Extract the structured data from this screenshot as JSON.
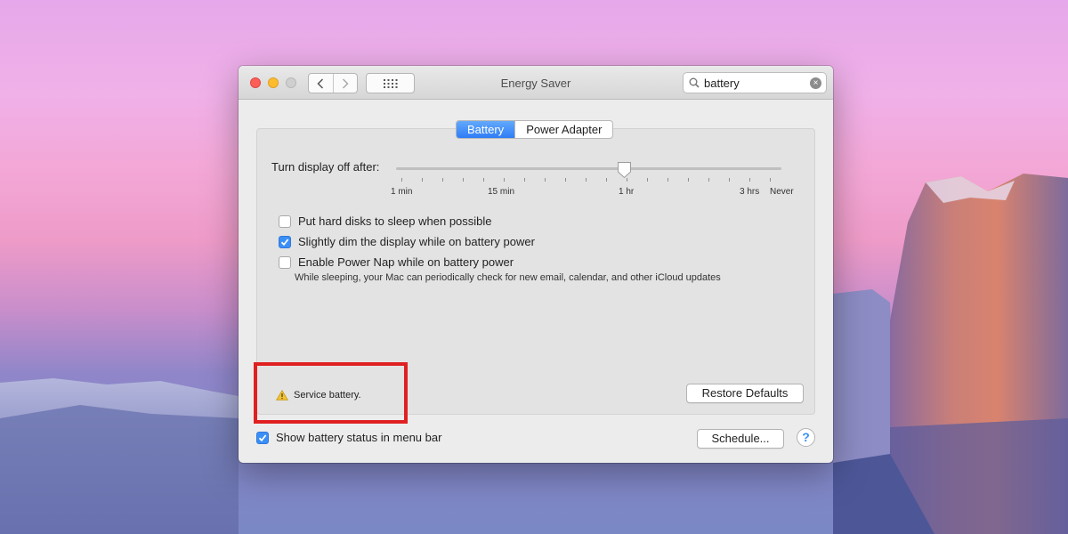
{
  "window": {
    "title": "Energy Saver",
    "search_value": "battery"
  },
  "tabs": [
    {
      "label": "Battery",
      "active": true
    },
    {
      "label": "Power Adapter",
      "active": false
    }
  ],
  "slider": {
    "label": "Turn display off after:",
    "current_value": "1 hr",
    "ticks": [
      "1 min",
      "15 min",
      "1 hr",
      "3 hrs",
      "Never"
    ]
  },
  "options": [
    {
      "label": "Put hard disks to sleep when possible",
      "checked": false
    },
    {
      "label": "Slightly dim the display while on battery power",
      "checked": true
    },
    {
      "label": "Enable Power Nap while on battery power",
      "checked": false
    }
  ],
  "power_nap_hint": "While sleeping, your Mac can periodically check for new email, calendar, and other iCloud updates",
  "warning": {
    "text": "Service battery.",
    "icon": "warning-triangle-icon"
  },
  "buttons": {
    "restore": "Restore Defaults",
    "schedule": "Schedule...",
    "help": "?"
  },
  "menu_bar_option": {
    "label": "Show battery status in menu bar",
    "checked": true
  },
  "colors": {
    "accent": "#3a8ff6",
    "highlight_box": "#e02020",
    "close": "#fc5f57",
    "minimize": "#fdbc2e"
  }
}
